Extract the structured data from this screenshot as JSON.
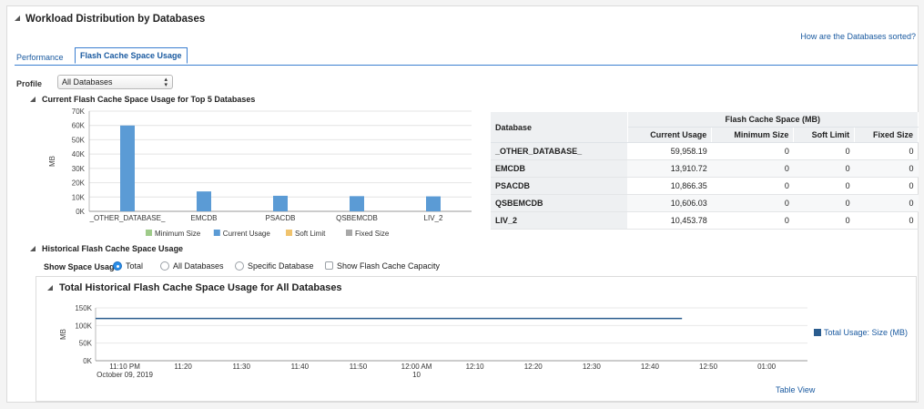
{
  "section": {
    "title": "Workload Distribution by Databases",
    "sort_link": "How are the Databases sorted?"
  },
  "tabs": [
    {
      "label": "Performance",
      "active": false
    },
    {
      "label": "Flash Cache Space Usage",
      "active": true
    }
  ],
  "profile": {
    "label": "Profile",
    "selected": "All Databases"
  },
  "current_usage": {
    "title": "Current Flash Cache Space Usage for Top 5 Databases"
  },
  "table": {
    "db_header": "Database",
    "group_header": "Flash Cache Space (MB)",
    "columns": [
      "Current Usage",
      "Minimum Size",
      "Soft Limit",
      "Fixed Size"
    ],
    "rows": [
      {
        "name": "_OTHER_DATABASE_",
        "current": "59,958.19",
        "min": "0",
        "soft": "0",
        "fixed": "0"
      },
      {
        "name": "EMCDB",
        "current": "13,910.72",
        "min": "0",
        "soft": "0",
        "fixed": "0"
      },
      {
        "name": "PSACDB",
        "current": "10,866.35",
        "min": "0",
        "soft": "0",
        "fixed": "0"
      },
      {
        "name": "QSBEMCDB",
        "current": "10,606.03",
        "min": "0",
        "soft": "0",
        "fixed": "0"
      },
      {
        "name": "LIV_2",
        "current": "10,453.78",
        "min": "0",
        "soft": "0",
        "fixed": "0"
      }
    ]
  },
  "historical": {
    "title": "Historical Flash Cache Space Usage",
    "show_label": "Show Space Usage",
    "options": [
      "Total",
      "All Databases",
      "Specific Database"
    ],
    "selected": "Total",
    "capacity_label": "Show Flash Cache Capacity",
    "panel_title": "Total Historical Flash Cache Space Usage for All Databases",
    "table_view": "Table View"
  },
  "colors": {
    "current": "#5b9bd5",
    "minimum": "#9fcb8a",
    "soft": "#f0c36d",
    "fixed": "#a8a8a8",
    "line": "#2a5c8e",
    "link": "#1a5aa0"
  },
  "chart_data": [
    {
      "type": "bar",
      "ylabel": "MB",
      "ylim": [
        0,
        70000
      ],
      "yticks": [
        "0K",
        "10K",
        "20K",
        "30K",
        "40K",
        "50K",
        "60K",
        "70K"
      ],
      "grid": true,
      "legend_position": "bottom",
      "categories": [
        "_OTHER_DATABASE_",
        "EMCDB",
        "PSACDB",
        "QSBEMCDB",
        "LIV_2"
      ],
      "series": [
        {
          "name": "Minimum Size",
          "values": [
            0,
            0,
            0,
            0,
            0
          ]
        },
        {
          "name": "Current Usage",
          "values": [
            59958.19,
            13910.72,
            10866.35,
            10606.03,
            10453.78
          ]
        },
        {
          "name": "Soft Limit",
          "values": [
            0,
            0,
            0,
            0,
            0
          ]
        },
        {
          "name": "Fixed Size",
          "values": [
            0,
            0,
            0,
            0,
            0
          ]
        }
      ]
    },
    {
      "type": "line",
      "ylabel": "MB",
      "ylim": [
        0,
        150000
      ],
      "yticks": [
        "0K",
        "50K",
        "100K",
        "150K"
      ],
      "grid": true,
      "legend_position": "right",
      "xticks": [
        {
          "t": 0,
          "label": "11:10 PM",
          "sub": "October 09, 2019"
        },
        {
          "t": 10,
          "label": "11:20"
        },
        {
          "t": 20,
          "label": "11:30"
        },
        {
          "t": 30,
          "label": "11:40"
        },
        {
          "t": 40,
          "label": "11:50"
        },
        {
          "t": 50,
          "label": "12:00 AM",
          "sub": "10"
        },
        {
          "t": 60,
          "label": "12:10"
        },
        {
          "t": 70,
          "label": "12:20"
        },
        {
          "t": 80,
          "label": "12:30"
        },
        {
          "t": 90,
          "label": "12:40"
        },
        {
          "t": 100,
          "label": "12:50"
        },
        {
          "t": 110,
          "label": "01:00"
        }
      ],
      "xlim": [
        -5,
        117
      ],
      "series": [
        {
          "name": "Total Usage: Size (MB)",
          "x": [
            -5,
            95.5
          ],
          "values": [
            120000,
            120000
          ]
        }
      ]
    }
  ]
}
